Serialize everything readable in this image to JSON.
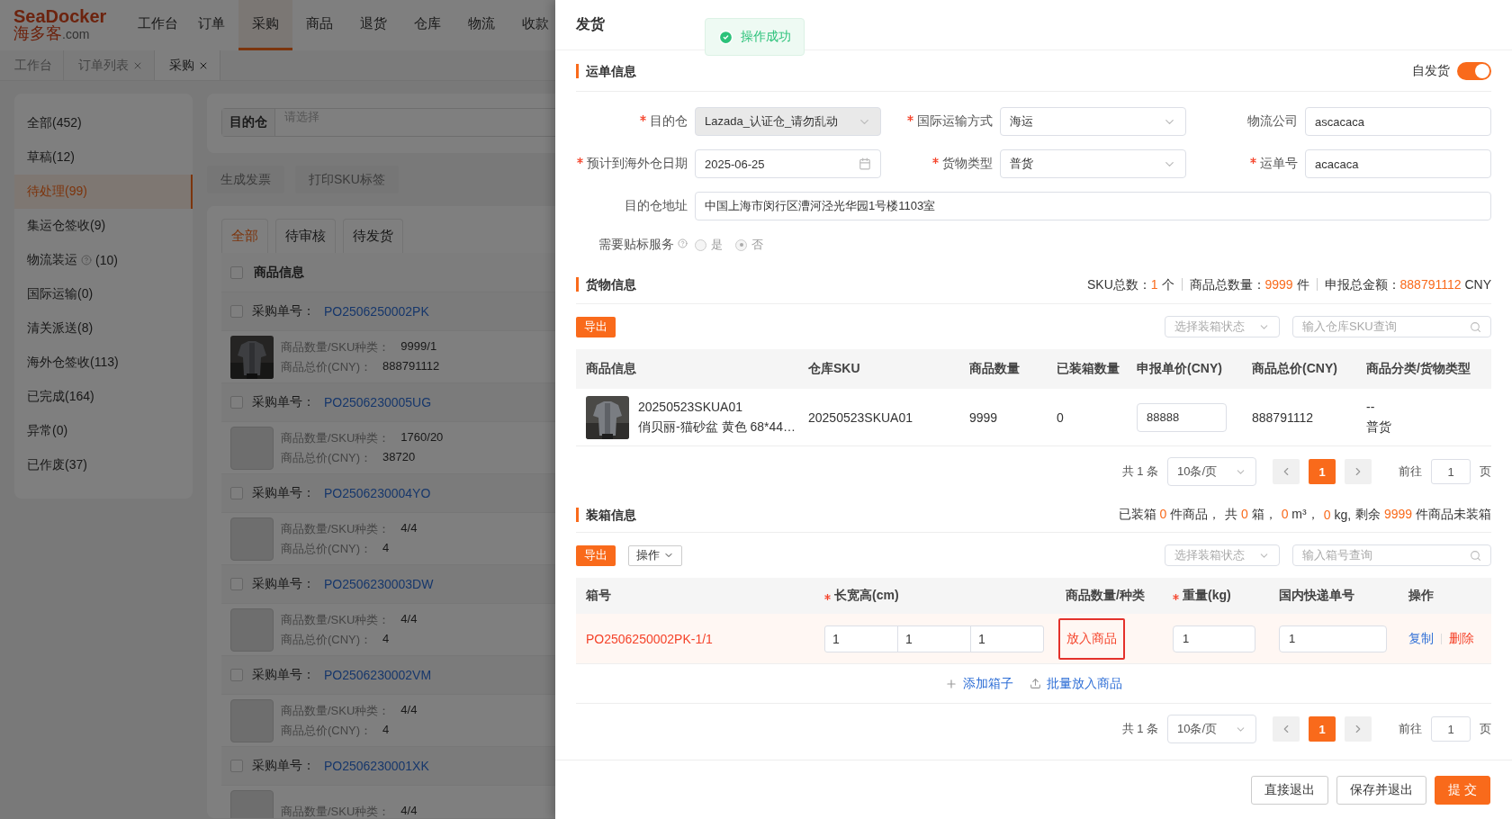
{
  "header": {
    "logo_top": "SeaDocker",
    "logo_bottom": "海多客",
    "logo_suffix": ".com",
    "nav": [
      {
        "label": "工作台",
        "selected": false
      },
      {
        "label": "订单",
        "selected": false
      },
      {
        "label": "采购",
        "selected": true
      },
      {
        "label": "商品",
        "selected": false
      },
      {
        "label": "退货",
        "selected": false
      },
      {
        "label": "仓库",
        "selected": false
      },
      {
        "label": "物流",
        "selected": false
      },
      {
        "label": "收款",
        "selected": false
      }
    ]
  },
  "tabs": [
    {
      "label": "工作台",
      "closable": false,
      "selected": false
    },
    {
      "label": "订单列表",
      "closable": true,
      "selected": false
    },
    {
      "label": "采购",
      "closable": true,
      "selected": true
    }
  ],
  "sidebar": [
    {
      "label": "全部(452)",
      "help": false,
      "selected": false
    },
    {
      "label": "草稿(12)",
      "help": false,
      "selected": false
    },
    {
      "label": "待处理(99)",
      "help": false,
      "selected": true
    },
    {
      "label": "集运仓签收(9)",
      "help": false,
      "selected": false
    },
    {
      "label": "物流装运",
      "help": true,
      "count": "(10)",
      "selected": false
    },
    {
      "label": "国际运输(0)",
      "help": false,
      "selected": false
    },
    {
      "label": "清关派送(8)",
      "help": false,
      "selected": false
    },
    {
      "label": "海外仓签收(113)",
      "help": false,
      "selected": false
    },
    {
      "label": "已完成(164)",
      "help": false,
      "selected": false
    },
    {
      "label": "异常(0)",
      "help": false,
      "selected": false
    },
    {
      "label": "已作废(37)",
      "help": false,
      "selected": false
    }
  ],
  "filter": {
    "label": "目的仓",
    "placeholder": "请选择"
  },
  "actions": [
    "生成发票",
    "打印SKU标签"
  ],
  "status_tabs": [
    {
      "label": "全部",
      "selected": true
    },
    {
      "label": "待审核",
      "selected": false
    },
    {
      "label": "待发货",
      "selected": false
    }
  ],
  "order_list": {
    "header": "商品信息",
    "header_checked": false,
    "orders": [
      {
        "label": "采购单号：",
        "number": "PO2506250002PK",
        "checked": false,
        "qty_label": "商品数量/SKU种类：",
        "qty": "9999/1",
        "price_label": "商品总价(CNY)：",
        "price": "888791112",
        "photo": true
      },
      {
        "label": "采购单号：",
        "number": "PO2506230005UG",
        "checked": false,
        "qty_label": "商品数量/SKU种类：",
        "qty": "1760/20",
        "price_label": "商品总价(CNY)：",
        "price": "38720",
        "photo": false
      },
      {
        "label": "采购单号：",
        "number": "PO2506230004YO",
        "checked": false,
        "qty_label": "商品数量/SKU种类：",
        "qty": "4/4",
        "price_label": "商品总价(CNY)：",
        "price": "4",
        "photo": false
      },
      {
        "label": "采购单号：",
        "number": "PO2506230003DW",
        "checked": false,
        "qty_label": "商品数量/SKU种类：",
        "qty": "4/4",
        "price_label": "商品总价(CNY)：",
        "price": "4",
        "photo": false
      },
      {
        "label": "采购单号：",
        "number": "PO2506230002VM",
        "checked": false,
        "qty_label": "商品数量/SKU种类：",
        "qty": "4/4",
        "price_label": "商品总价(CNY)：",
        "price": "4",
        "photo": false
      },
      {
        "label": "采购单号：",
        "number": "PO2506230001XK",
        "checked": false,
        "qty_label": "商品数量/SKU种类：",
        "qty": "4/4",
        "photo": false
      }
    ]
  },
  "drawer": {
    "title": "发货",
    "toast": "操作成功",
    "waybill": {
      "title": "运单信息",
      "self_ship": {
        "label": "自发货",
        "on": true
      },
      "fields": [
        {
          "label": "目的仓",
          "required": true,
          "kind": "select",
          "value": "Lazada_认证仓_请勿乱动",
          "disabled": true
        },
        {
          "label": "国际运输方式",
          "required": true,
          "kind": "select",
          "value": "海运",
          "disabled": false
        },
        {
          "label": "物流公司",
          "required": false,
          "kind": "text",
          "value": "ascacaca",
          "disabled": false
        },
        {
          "label": "预计到海外仓日期",
          "required": true,
          "kind": "date",
          "value": "2025-06-25",
          "disabled": false
        },
        {
          "label": "货物类型",
          "required": true,
          "kind": "select",
          "value": "普货",
          "disabled": false
        },
        {
          "label": "运单号",
          "required": true,
          "kind": "text",
          "value": "acacaca",
          "disabled": false
        }
      ],
      "address": {
        "label": "目的仓地址",
        "value": "中国上海市闵行区漕河泾光华园1号楼1103室"
      },
      "label_service": {
        "label": "需要贴标服务",
        "options": [
          {
            "label": "是",
            "selected": false
          },
          {
            "label": "否",
            "selected": true
          }
        ]
      }
    },
    "goods": {
      "title": "货物信息",
      "summary": [
        {
          "label": "SKU总数：",
          "value": "1",
          "unit": "个"
        },
        {
          "label": "商品总数量：",
          "value": "9999",
          "unit": "件"
        },
        {
          "label": "申报总金额：",
          "value": "888791112",
          "unit": "CNY"
        }
      ],
      "export": "导出",
      "status_placeholder": "选择装箱状态",
      "search_placeholder": "输入仓库SKU查询",
      "columns": [
        "商品信息",
        "仓库SKU",
        "商品数量",
        "已装箱数量",
        "申报单价(CNY)",
        "商品总价(CNY)",
        "商品分类/货物类型"
      ],
      "rows": [
        {
          "sku_code": "20250523SKUA01",
          "name": "俏贝丽-猫砂盆 黄色 68*44…",
          "warehouse_sku": "20250523SKUA01",
          "qty": "9999",
          "packed": "0",
          "unit_price": "88888",
          "total": "888791112",
          "category": "--",
          "cargo_type": "普货"
        }
      ],
      "pagination": {
        "total": "共 1 条",
        "page_size": "10条/页",
        "pages": [
          {
            "label": "1",
            "selected": true
          }
        ],
        "goto_label": "前往",
        "goto_value": "1",
        "page_unit": "页"
      }
    },
    "packing": {
      "title": "装箱信息",
      "summary": [
        {
          "label": "已装箱",
          "value": "0",
          "unit": "件商品，"
        },
        {
          "label": "共",
          "value": "0",
          "unit": "箱，"
        },
        {
          "value": "0",
          "unit": "m³，"
        },
        {
          "value": "0",
          "unit": "kg,"
        },
        {
          "label": "剩余",
          "value": "9999",
          "unit": "件商品未装箱"
        }
      ],
      "export": "导出",
      "operations": "操作",
      "status_placeholder": "选择装箱状态",
      "search_placeholder": "输入箱号查询",
      "columns": [
        {
          "label": "箱号",
          "required": false
        },
        {
          "label": "长宽高(cm)",
          "required": true
        },
        {
          "label": "商品数量/种类",
          "required": false
        },
        {
          "label": "重量(kg)",
          "required": true
        },
        {
          "label": "国内快递单号",
          "required": false
        },
        {
          "label": "操作",
          "required": false
        }
      ],
      "rows": [
        {
          "box_no": "PO2506250002PK-1/1",
          "dims": [
            "1",
            "1",
            "1"
          ],
          "put_goods": "放入商品",
          "weight": "1",
          "tracking": "1",
          "actions": [
            {
              "label": "复制",
              "kind": "link"
            },
            {
              "label": "删除",
              "kind": "danger"
            }
          ]
        }
      ],
      "add_links": [
        {
          "label": "添加箱子",
          "kind": "plus"
        },
        {
          "label": "批量放入商品",
          "kind": "upload"
        }
      ],
      "pagination": {
        "total": "共 1 条",
        "page_size": "10条/页",
        "pages": [
          {
            "label": "1",
            "selected": true
          }
        ],
        "goto_label": "前往",
        "goto_value": "1",
        "page_unit": "页"
      }
    },
    "footer": [
      {
        "label": "直接退出",
        "kind": "default"
      },
      {
        "label": "保存并退出",
        "kind": "default"
      },
      {
        "label": "提 交",
        "kind": "primary"
      }
    ]
  }
}
